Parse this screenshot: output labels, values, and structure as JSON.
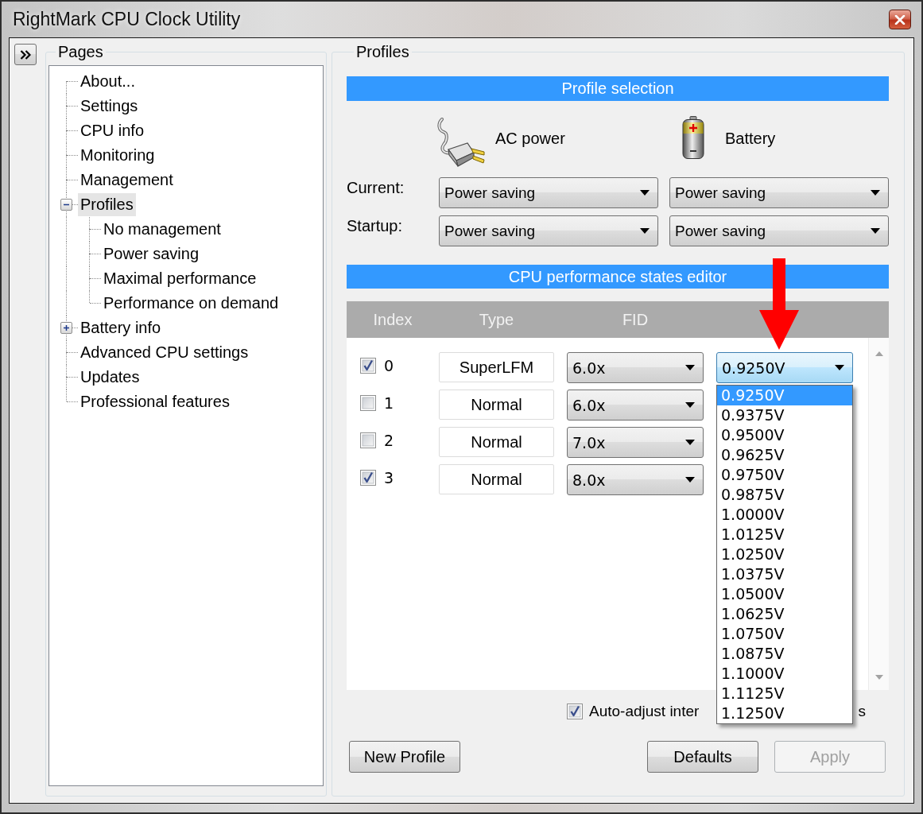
{
  "window": {
    "title": "RightMark CPU Clock Utility"
  },
  "pages": {
    "title": "Pages",
    "items": [
      {
        "label": "About...",
        "selected": false
      },
      {
        "label": "Settings",
        "selected": false
      },
      {
        "label": "CPU info",
        "selected": false
      },
      {
        "label": "Monitoring",
        "selected": false
      },
      {
        "label": "Management",
        "selected": false
      },
      {
        "label": "Profiles",
        "selected": true,
        "expanded": true,
        "children": [
          {
            "label": "No management",
            "selected": false
          },
          {
            "label": "Power saving",
            "selected": false
          },
          {
            "label": "Maximal performance",
            "selected": false
          },
          {
            "label": "Performance on demand",
            "selected": false
          }
        ]
      },
      {
        "label": "Battery info",
        "selected": false,
        "expanded": false
      },
      {
        "label": "Advanced CPU settings",
        "selected": false
      },
      {
        "label": "Updates",
        "selected": false
      },
      {
        "label": "Professional features",
        "selected": false
      }
    ]
  },
  "profiles": {
    "title": "Profiles",
    "profile_selection": {
      "title": "Profile selection",
      "sources": [
        {
          "kind": "ac",
          "label": "AC power"
        },
        {
          "kind": "battery",
          "label": "Battery"
        }
      ],
      "rows": [
        {
          "label": "Current:",
          "values": [
            "Power saving",
            "Power saving"
          ]
        },
        {
          "label": "Startup:",
          "values": [
            "Power saving",
            "Power saving"
          ]
        }
      ]
    },
    "editor": {
      "title": "CPU performance states editor",
      "columns": [
        "Index",
        "Type",
        "FID"
      ],
      "rows": [
        {
          "enabled": true,
          "index": "0",
          "type": "SuperLFM",
          "fid": "6.0x",
          "vid": {
            "value": "0.9250V",
            "open": true,
            "annotation": {
              "kind": "arrow"
            },
            "options": [
              {
                "label": "0.9250V",
                "selected": true
              },
              {
                "label": "0.9375V",
                "selected": false
              },
              {
                "label": "0.9500V",
                "selected": false
              },
              {
                "label": "0.9625V",
                "selected": false
              },
              {
                "label": "0.9750V",
                "selected": false
              },
              {
                "label": "0.9875V",
                "selected": false
              },
              {
                "label": "1.0000V",
                "selected": false
              },
              {
                "label": "1.0125V",
                "selected": false
              },
              {
                "label": "1.0250V",
                "selected": false
              },
              {
                "label": "1.0375V",
                "selected": false
              },
              {
                "label": "1.0500V",
                "selected": false
              },
              {
                "label": "1.0625V",
                "selected": false
              },
              {
                "label": "1.0750V",
                "selected": false
              },
              {
                "label": "1.0875V",
                "selected": false
              },
              {
                "label": "1.1000V",
                "selected": false
              },
              {
                "label": "1.1125V",
                "selected": false
              },
              {
                "label": "1.1250V",
                "selected": false
              }
            ]
          }
        },
        {
          "enabled": false,
          "index": "1",
          "type": "Normal",
          "fid": "6.0x"
        },
        {
          "enabled": false,
          "index": "2",
          "type": "Normal",
          "fid": "7.0x"
        },
        {
          "enabled": true,
          "index": "3",
          "type": "Normal",
          "fid": "8.0x"
        }
      ],
      "auto_adjust": {
        "checked": true,
        "label": "Auto-adjust inter",
        "label_end": "s"
      }
    },
    "buttons": {
      "left": [
        {
          "label": "New Profile",
          "disabled": false
        }
      ],
      "right": [
        {
          "label": "Defaults",
          "disabled": false
        },
        {
          "label": "Apply",
          "disabled": true
        }
      ]
    }
  }
}
